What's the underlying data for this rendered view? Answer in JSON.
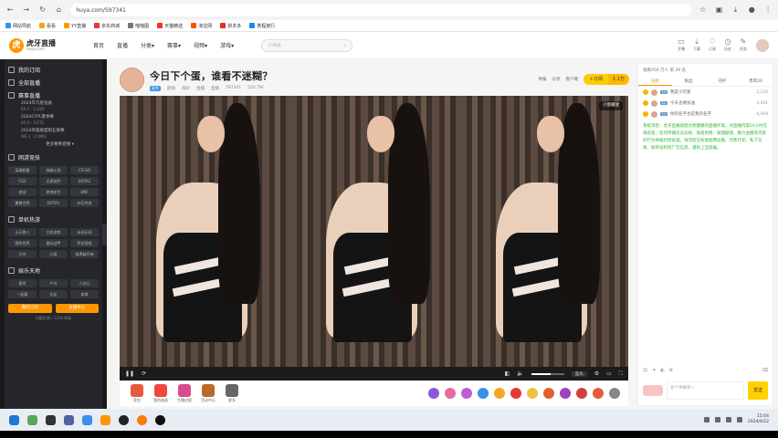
{
  "browser": {
    "url": "huya.com/597341",
    "bookmarks": [
      "网站导航",
      "看看",
      "YY直播",
      "京东商城",
      "喵喵图",
      "天猫精选",
      "淘宝网",
      "拼多多",
      "携程旅行"
    ]
  },
  "site": {
    "logo_cn": "虎牙直播",
    "logo_en": "huya.com",
    "nav": [
      "首页",
      "直播",
      "分类▾",
      "赛事▾",
      "视频▾",
      "游戏▾"
    ],
    "search_placeholder": "小仙女",
    "header_icons": [
      "开播",
      "下载",
      "订阅",
      "历史",
      "任务"
    ]
  },
  "sidebar": {
    "sections": [
      {
        "label": "我的订阅"
      },
      {
        "label": "全部直播"
      },
      {
        "label": "赛事直播"
      }
    ],
    "events": [
      {
        "title": "2024年凡星准备",
        "sub": "RA 1 : 1 LGD"
      },
      {
        "title": "2024CFPL夏季赛",
        "sub": "AG 0 : 0 ETS"
      },
      {
        "title": "2024英雄联盟职业联赛",
        "sub": "WE 1 : 2 OMG"
      }
    ],
    "more_events": "更多赛事直播 ▾",
    "online_games_label": "网游竞技",
    "online_games": [
      "英雄联盟",
      "穿越火线",
      "CS:GO",
      "CS2",
      "无畏契约",
      "DOTA2",
      "逆战",
      "绝地求生",
      "DNF",
      "魔兽世界",
      "DOTA1",
      "炉石传说"
    ],
    "mobile_games_label": "单机热游",
    "mobile_games": [
      "天天狼人",
      "主机游戏",
      "永劫无间",
      "我的世界",
      "星际战甲",
      "怀旧游戏",
      "方舟",
      "刀塔",
      "暗黑破坏神"
    ],
    "entertainment_label": "娱乐天地",
    "entertainment": [
      "星秀",
      "户外",
      "二次元",
      "一起看",
      "交友",
      "体育"
    ],
    "buttons": [
      "我的订阅",
      "主播中心"
    ],
    "footer": "问题反馈 | 1234 帮助"
  },
  "room": {
    "title": "今日下个蛋，谁看不迷糊？",
    "tag": "星秀",
    "meta": [
      "颜值",
      "海好",
      "直播",
      "直播",
      "597341",
      "520.7W"
    ],
    "actions": [
      "举报",
      "分享",
      "客户端"
    ],
    "subscribe_label": "＋订阅",
    "subscribe_count": "1.1万",
    "overlay_button": "小窗播放"
  },
  "player": {
    "quality": "蓝光",
    "volume_percent": 60,
    "controls": [
      "❚❚",
      "⟳"
    ]
  },
  "gifts": [
    "背包",
    "我的道具",
    "主播应援",
    "活动中心",
    "更多"
  ],
  "chat": {
    "header": "观看456 万人   第 39 名",
    "tabs": [
      "贡献",
      "粉丝",
      "守护",
      "贵宾26"
    ],
    "ranks": [
      {
        "name": "我是小可爱",
        "value": "3,220"
      },
      {
        "name": "今天也要加油",
        "value": "3,441"
      },
      {
        "name": "你的名字也是我的名字",
        "value": "4,569"
      }
    ],
    "notice": "系统消息：虎牙直播提倡文明健康的直播环境，对直播内容24小时在线巡查，任何传播违法违规、低俗色情、吸烟酗酒、暴力血腥等内容的行为将被封禁处理。请勿轻信各类招聘征婚、代练代充、私下交易、刷单返利等广告信息，谨防上当受骗。",
    "input_placeholder": "发个弹幕呗~",
    "send_label": "发送"
  },
  "taskbar": {
    "time": "15:04",
    "date": "2024/6/22"
  },
  "colors": {
    "accent": "#ff9600",
    "subscribe": "#ffcc00",
    "notice": "#2eb82e",
    "sidebar_bg": "#24262b"
  }
}
